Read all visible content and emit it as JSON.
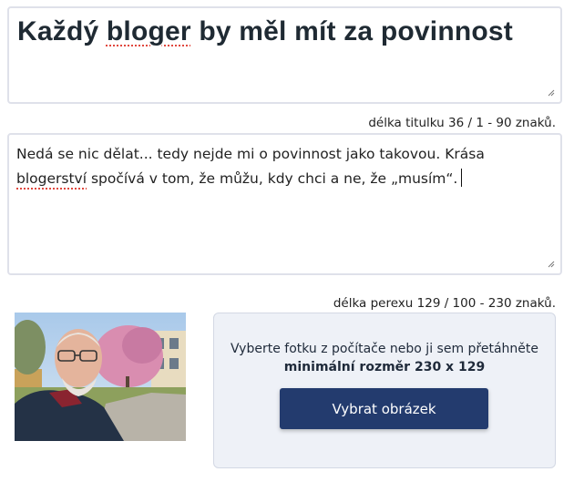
{
  "title": {
    "word1": "Každý ",
    "word2": "bloger",
    "rest": " by měl mít za povinnost",
    "counter": "délka titulku 36 / 1 - 90 znaků."
  },
  "perex": {
    "line1": "Nedá se nic dělat... tedy nejde mi o povinnost jako takovou. Krása",
    "line2_misspelled": "blogerství",
    "line2_rest": " spočívá v tom, že můžu, kdy chci a ne, že „musím“.",
    "counter": "délka perexu 129 / 100 - 230 znaků."
  },
  "upload": {
    "hint": "Vyberte fotku z počítače nebo ji sem přetáhněte",
    "min_size": "minimální rozměr 230 x 129",
    "button_label": "Vybrat obrázek"
  },
  "colors": {
    "button_bg": "#233b6e",
    "upload_bg": "#eef1f7",
    "spellcheck_underline": "#e0483e"
  }
}
